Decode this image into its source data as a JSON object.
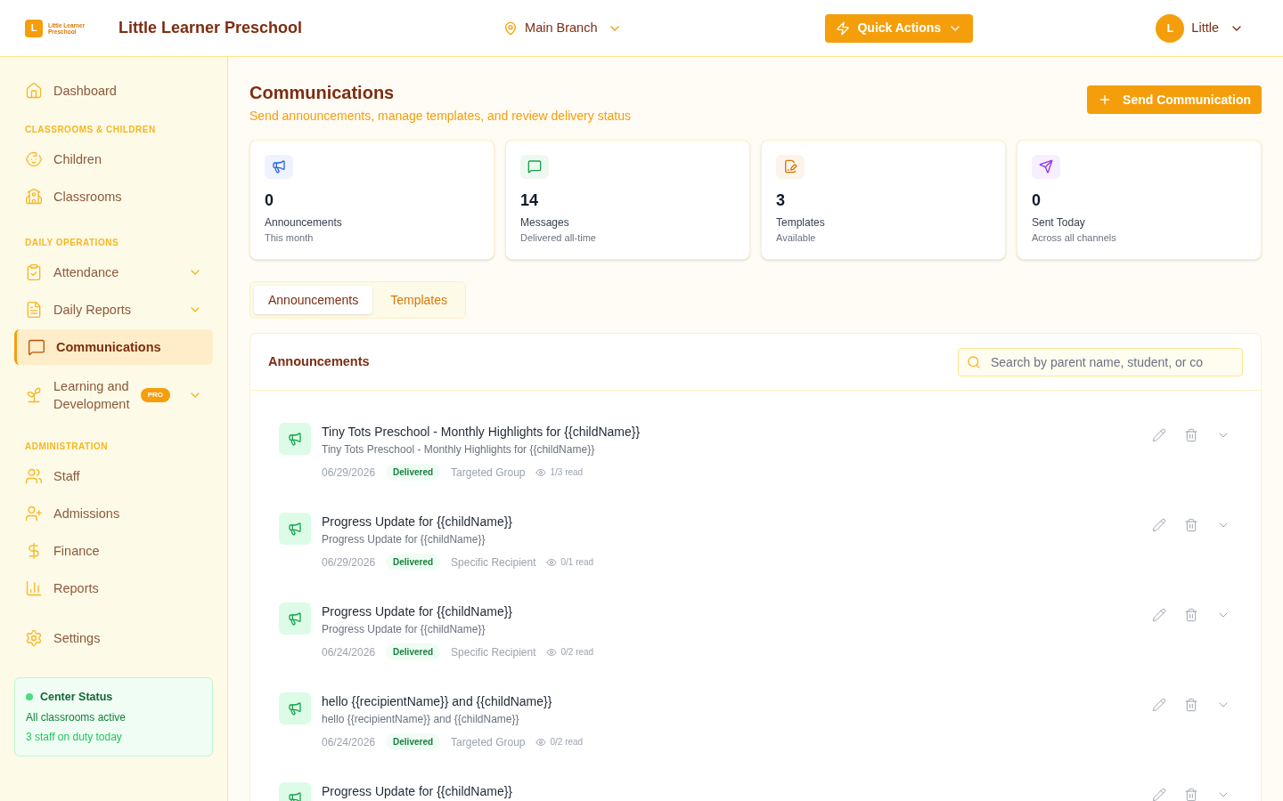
{
  "header": {
    "logo_letter": "L",
    "logo_text": "Little Learner Preschool",
    "school_name": "Little Learner Preschool",
    "branch": "Main Branch",
    "quick_actions": "Quick Actions",
    "user_initial": "L",
    "user_name": "Little"
  },
  "sidebar": {
    "items": [
      {
        "kind": "link",
        "label": "Dashboard",
        "selected": false,
        "has_submenu": false
      },
      {
        "kind": "heading",
        "label": "CLASSROOMS & CHILDREN"
      },
      {
        "kind": "link",
        "label": "Children",
        "selected": false,
        "has_submenu": false
      },
      {
        "kind": "link",
        "label": "Classrooms",
        "selected": false,
        "has_submenu": false
      },
      {
        "kind": "heading",
        "label": "DAILY OPERATIONS"
      },
      {
        "kind": "link",
        "label": "Attendance",
        "selected": false,
        "has_submenu": true
      },
      {
        "kind": "link",
        "label": "Daily Reports",
        "selected": false,
        "has_submenu": true
      },
      {
        "kind": "link",
        "label": "Communications",
        "selected": true,
        "has_submenu": false
      },
      {
        "kind": "link",
        "label": "Learning and Development",
        "selected": false,
        "has_submenu": true,
        "badge": "PRO"
      },
      {
        "kind": "heading",
        "label": "ADMINISTRATION"
      },
      {
        "kind": "link",
        "label": "Staff",
        "selected": false,
        "has_submenu": false
      },
      {
        "kind": "link",
        "label": "Admissions",
        "selected": false,
        "has_submenu": false
      },
      {
        "kind": "link",
        "label": "Finance",
        "selected": false,
        "has_submenu": false
      },
      {
        "kind": "link",
        "label": "Reports",
        "selected": false,
        "has_submenu": false
      },
      {
        "kind": "link",
        "label": "Settings",
        "selected": false,
        "has_submenu": false
      }
    ],
    "status_card": {
      "title": "Center Status",
      "line1": "All classrooms active",
      "line2": "3 staff on duty today",
      "color": "#4ade80"
    }
  },
  "page": {
    "title": "Communications",
    "subtitle": "Send announcements, manage templates, and review delivery status",
    "send_button": "Send Communication"
  },
  "stats": [
    {
      "value": "0",
      "label": "Announcements",
      "note": "This month",
      "color": "#2563eb"
    },
    {
      "value": "14",
      "label": "Messages",
      "note": "Delivered all-time",
      "color": "#16a34a"
    },
    {
      "value": "3",
      "label": "Templates",
      "note": "Available",
      "color": "#d97706"
    },
    {
      "value": "0",
      "label": "Sent Today",
      "note": "Across all channels",
      "color": "#9333ea"
    }
  ],
  "tabs": [
    {
      "label": "Announcements",
      "selected": true
    },
    {
      "label": "Templates",
      "selected": false
    }
  ],
  "panel": {
    "title": "Announcements",
    "search_placeholder": "Search by parent name, student, or co"
  },
  "announcements": [
    {
      "title": "Tiny Tots Preschool - Monthly Highlights for {{childName}}",
      "subtitle": "Tiny Tots Preschool - Monthly Highlights for {{childName}}",
      "date": "06/29/2026",
      "status": "Delivered",
      "audience": "Targeted Group",
      "reads": "1/3 read"
    },
    {
      "title": "Progress Update for {{childName}}",
      "subtitle": "Progress Update for {{childName}}",
      "date": "06/29/2026",
      "status": "Delivered",
      "audience": "Specific Recipient",
      "reads": "0/1 read"
    },
    {
      "title": "Progress Update for {{childName}}",
      "subtitle": "Progress Update for {{childName}}",
      "date": "06/24/2026",
      "status": "Delivered",
      "audience": "Specific Recipient",
      "reads": "0/2 read"
    },
    {
      "title": "hello {{recipientName}} and {{childName}}",
      "subtitle": "hello {{recipientName}} and {{childName}}",
      "date": "06/24/2026",
      "status": "Delivered",
      "audience": "Targeted Group",
      "reads": "0/2 read"
    },
    {
      "title": "Progress Update for {{childName}}"
    }
  ]
}
